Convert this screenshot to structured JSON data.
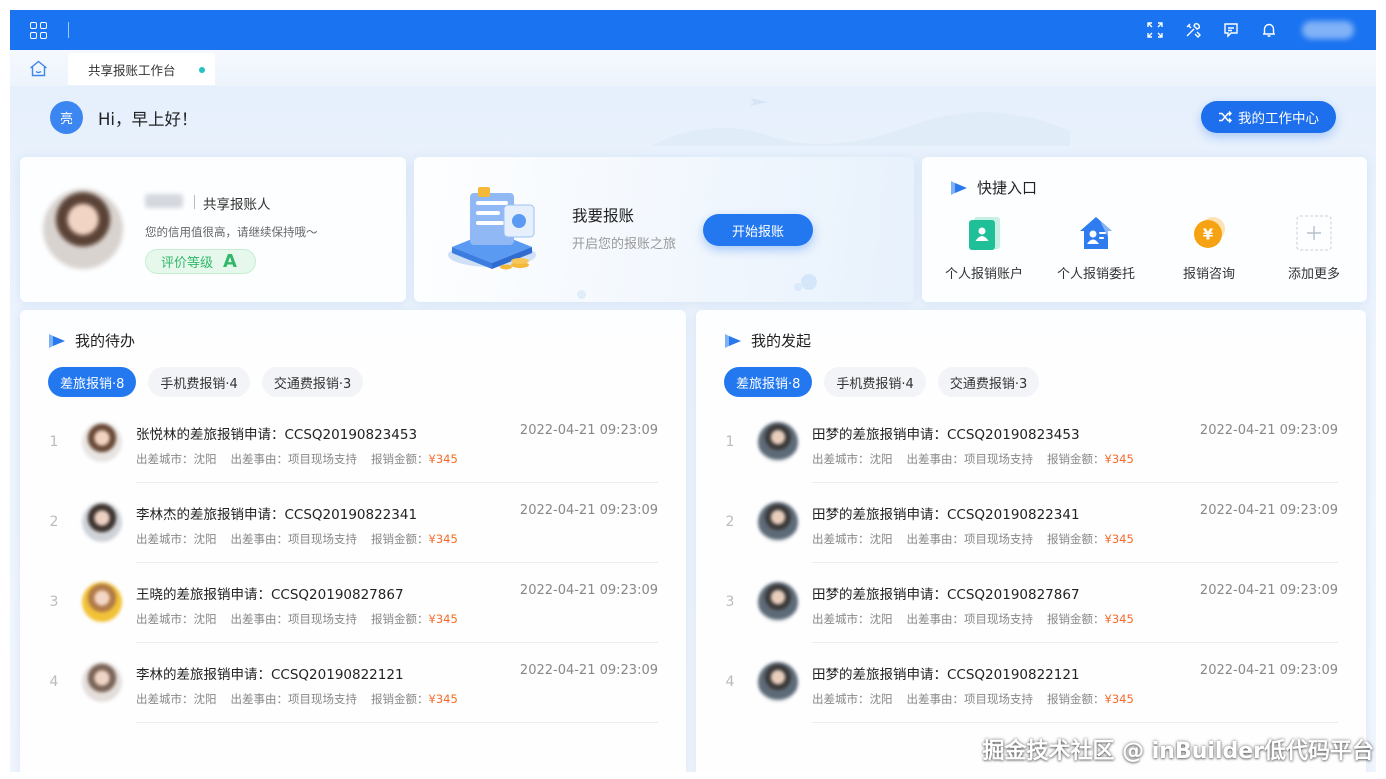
{
  "header": {
    "tab_label": "共享报账工作台"
  },
  "greeting": {
    "avatar_char": "亮",
    "text": "Hi，早上好！",
    "work_center": "我的工作中心"
  },
  "profile": {
    "role": "共享报账人",
    "credit": "您的信用值很高，请继续保持哦～",
    "grade_label": "评价等级",
    "grade_value": "A"
  },
  "reimburse": {
    "title": "我要报账",
    "subtitle": "开启您的报账之旅",
    "button": "开始报账"
  },
  "quick": {
    "title": "快捷入口",
    "items": [
      {
        "label": "个人报销账户",
        "icon": "personal-account-icon",
        "color": "#1fbf97"
      },
      {
        "label": "个人报销委托",
        "icon": "delegate-icon",
        "color": "#2f7cf0"
      },
      {
        "label": "报销咨询",
        "icon": "yuan-consult-icon",
        "color": "#f5a312"
      },
      {
        "label": "添加更多",
        "icon": "plus-icon",
        "color": "#c0c8d2"
      }
    ]
  },
  "todo": {
    "title": "我的待办",
    "filters": [
      "差旅报销·8",
      "手机费报销·4",
      "交通费报销·3"
    ],
    "rows": [
      {
        "idx": "1",
        "title": "张悦林的差旅报销申请：CCSQ20190823453",
        "time": "2022-04-21 09:23:09",
        "city": "出差城市：沈阳",
        "reason": "出差事由：项目现场支持",
        "amount_label": "报销金额：",
        "amount": "¥345"
      },
      {
        "idx": "2",
        "title": "李林杰的差旅报销申请：CCSQ20190822341",
        "time": "2022-04-21 09:23:09",
        "city": "出差城市：沈阳",
        "reason": "出差事由：项目现场支持",
        "amount_label": "报销金额：",
        "amount": "¥345"
      },
      {
        "idx": "3",
        "title": "王晓的差旅报销申请：CCSQ20190827867",
        "time": "2022-04-21 09:23:09",
        "city": "出差城市：沈阳",
        "reason": "出差事由：项目现场支持",
        "amount_label": "报销金额：",
        "amount": "¥345"
      },
      {
        "idx": "4",
        "title": "李林的差旅报销申请：CCSQ20190822121",
        "time": "2022-04-21 09:23:09",
        "city": "出差城市：沈阳",
        "reason": "出差事由：项目现场支持",
        "amount_label": "报销金额：",
        "amount": "¥345"
      }
    ]
  },
  "initiated": {
    "title": "我的发起",
    "filters": [
      "差旅报销·8",
      "手机费报销·4",
      "交通费报销·3"
    ],
    "rows": [
      {
        "idx": "1",
        "title": "田梦的差旅报销申请：CCSQ20190823453",
        "time": "2022-04-21 09:23:09",
        "city": "出差城市：沈阳",
        "reason": "出差事由：项目现场支持",
        "amount_label": "报销金额：",
        "amount": "¥345"
      },
      {
        "idx": "2",
        "title": "田梦的差旅报销申请：CCSQ20190822341",
        "time": "2022-04-21 09:23:09",
        "city": "出差城市：沈阳",
        "reason": "出差事由：项目现场支持",
        "amount_label": "报销金额：",
        "amount": "¥345"
      },
      {
        "idx": "3",
        "title": "田梦的差旅报销申请：CCSQ20190827867",
        "time": "2022-04-21 09:23:09",
        "city": "出差城市：沈阳",
        "reason": "出差事由：项目现场支持",
        "amount_label": "报销金额：",
        "amount": "¥345"
      },
      {
        "idx": "4",
        "title": "田梦的差旅报销申请：CCSQ20190822121",
        "time": "2022-04-21 09:23:09",
        "city": "出差城市：沈阳",
        "reason": "出差事由：项目现场支持",
        "amount_label": "报销金额：",
        "amount": "¥345"
      }
    ]
  },
  "watermark": "掘金技术社区 @ inBuilder低代码平台",
  "colors": {
    "primary": "#1a73f0",
    "amount": "#f56c2c",
    "grade": "#33b86a"
  }
}
